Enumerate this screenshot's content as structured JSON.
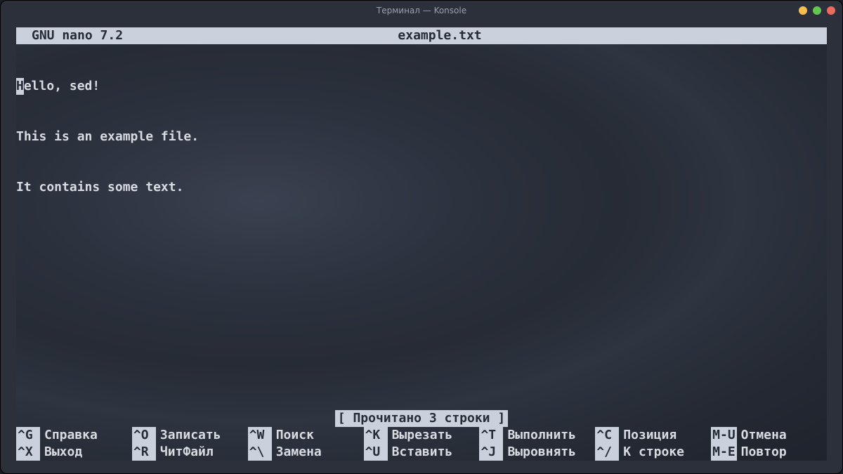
{
  "window": {
    "title": "Терминал — Konsole"
  },
  "nano": {
    "app": "GNU nano 7.2",
    "filename": "example.txt",
    "status": "[ Прочитано 3 строки ]",
    "lines": [
      "Hello, sed!",
      "This is an example file.",
      "It contains some text."
    ]
  },
  "shortcuts": {
    "row1": [
      {
        "key": "^G",
        "label": "Справка"
      },
      {
        "key": "^O",
        "label": "Записать"
      },
      {
        "key": "^W",
        "label": "Поиск"
      },
      {
        "key": "^K",
        "label": "Вырезать"
      },
      {
        "key": "^T",
        "label": "Выполнить"
      },
      {
        "key": "^C",
        "label": "Позиция"
      },
      {
        "key": "M-U",
        "label": "Отмена"
      }
    ],
    "row2": [
      {
        "key": "^X",
        "label": "Выход"
      },
      {
        "key": "^R",
        "label": "ЧитФайл"
      },
      {
        "key": "^\\",
        "label": "Замена"
      },
      {
        "key": "^U",
        "label": "Вставить"
      },
      {
        "key": "^J",
        "label": "Выровнять"
      },
      {
        "key": "^/",
        "label": "К строке"
      },
      {
        "key": "M-E",
        "label": "Повтор"
      }
    ]
  }
}
